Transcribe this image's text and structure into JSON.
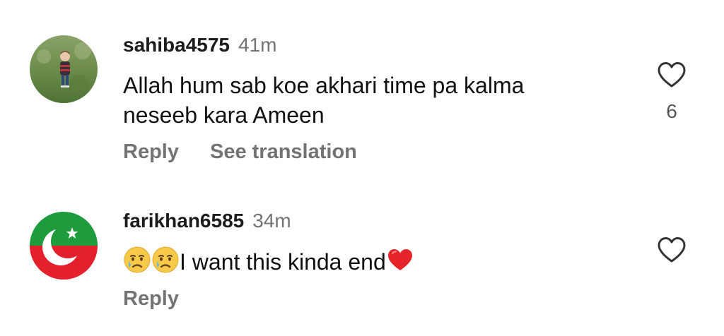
{
  "comments": [
    {
      "username": "sahiba4575",
      "time": "41m",
      "text_line1": "Allah hum sab koe akhari time pa kalma",
      "text_line2": "neseeb kara Ameen",
      "reply_label": "Reply",
      "translate_label": "See translation",
      "like_count": "6",
      "avatar": "photo-child-on-grass"
    },
    {
      "username": "farikhan6585",
      "time": "34m",
      "text": "I want this kinda end",
      "reply_label": "Reply",
      "avatar": "flag-green-red-crescent-star",
      "emojis": [
        "crying-face-emoji",
        "crying-face-emoji",
        "red-heart-emoji"
      ]
    }
  ],
  "icons": {
    "like": "heart-outline-icon"
  },
  "colors": {
    "text": "#111111",
    "muted": "#737373",
    "flag_green": "#1e9b3c",
    "flag_red": "#e3202b"
  }
}
